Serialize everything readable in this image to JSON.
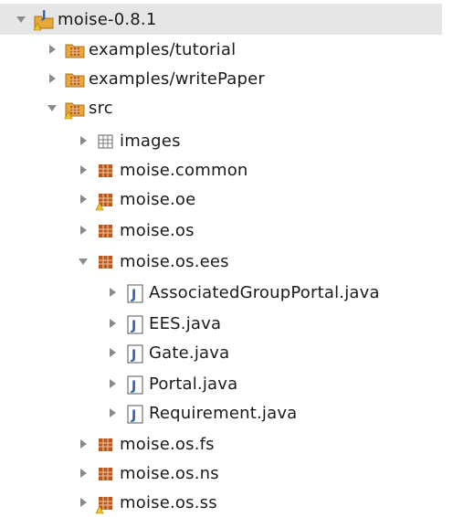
{
  "tree": {
    "project": {
      "label": "moise-0.8.1",
      "expanded": true
    },
    "items": [
      {
        "label": "examples/tutorial",
        "type": "source-folder",
        "expanded": false
      },
      {
        "label": "examples/writePaper",
        "type": "source-folder",
        "expanded": false
      },
      {
        "label": "src",
        "type": "source-folder",
        "expanded": true,
        "warning": true
      },
      {
        "label": "images",
        "type": "package-empty",
        "expanded": false
      },
      {
        "label": "moise.common",
        "type": "package",
        "expanded": false
      },
      {
        "label": "moise.oe",
        "type": "package",
        "expanded": false,
        "warning": true
      },
      {
        "label": "moise.os",
        "type": "package",
        "expanded": false
      },
      {
        "label": "moise.os.ees",
        "type": "package",
        "expanded": true
      },
      {
        "label": "AssociatedGroupPortal.java",
        "type": "java-file",
        "expanded": false
      },
      {
        "label": "EES.java",
        "type": "java-file",
        "expanded": false
      },
      {
        "label": "Gate.java",
        "type": "java-file",
        "expanded": false
      },
      {
        "label": "Portal.java",
        "type": "java-file",
        "expanded": false
      },
      {
        "label": "Requirement.java",
        "type": "java-file",
        "expanded": false
      },
      {
        "label": "moise.os.fs",
        "type": "package",
        "expanded": false
      },
      {
        "label": "moise.os.ns",
        "type": "package",
        "expanded": false
      },
      {
        "label": "moise.os.ss",
        "type": "package",
        "expanded": false,
        "warning": true
      }
    ]
  },
  "colors": {
    "selection": "#e6e6e6",
    "package": "#b85a1f",
    "folder": "#e8a93a",
    "java": "#2f5fb0",
    "arrow": "#8c8c8c",
    "warning": "#f0c419"
  }
}
